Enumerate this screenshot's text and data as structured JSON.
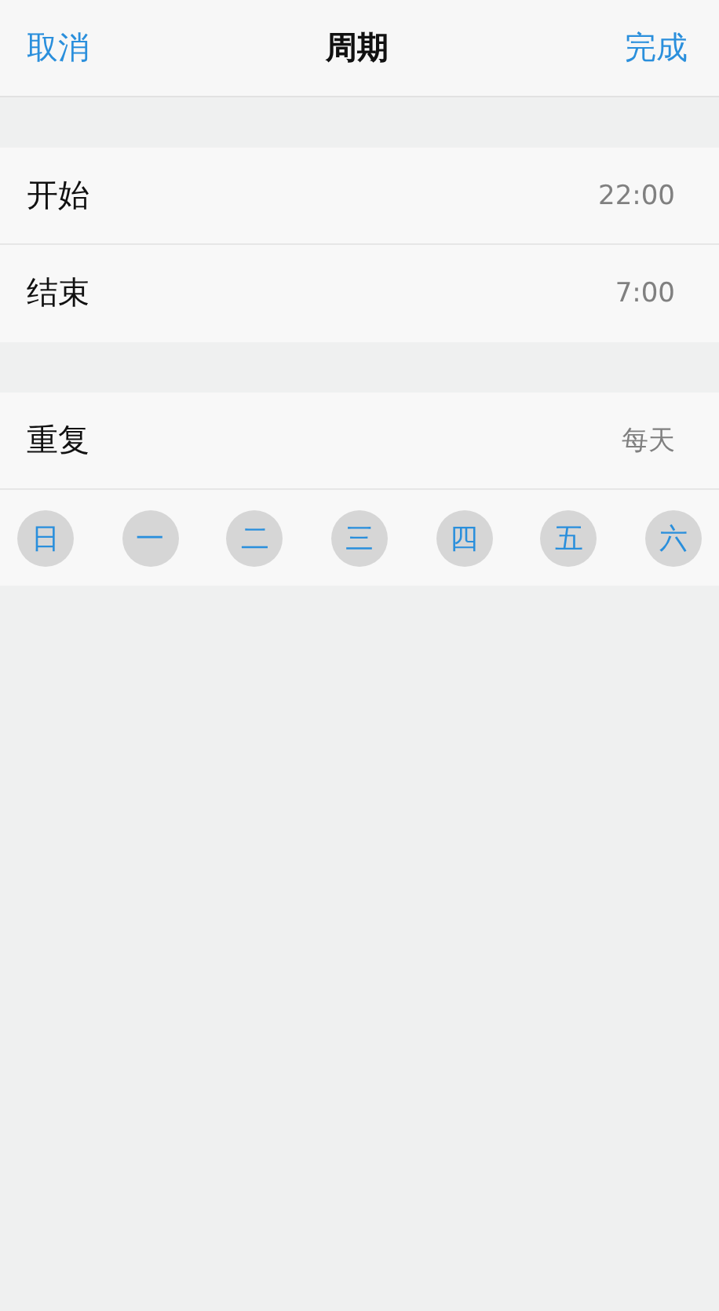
{
  "nav": {
    "cancel": "取消",
    "title": "周期",
    "done": "完成"
  },
  "time_rows": [
    {
      "label": "开始",
      "value": "22:00"
    },
    {
      "label": "结束",
      "value": "7:00"
    }
  ],
  "repeat": {
    "label": "重复",
    "value": "每天"
  },
  "days": [
    {
      "label": "日",
      "selected": true
    },
    {
      "label": "一",
      "selected": true
    },
    {
      "label": "二",
      "selected": true
    },
    {
      "label": "三",
      "selected": true
    },
    {
      "label": "四",
      "selected": true
    },
    {
      "label": "五",
      "selected": true
    },
    {
      "label": "六",
      "selected": true
    }
  ]
}
